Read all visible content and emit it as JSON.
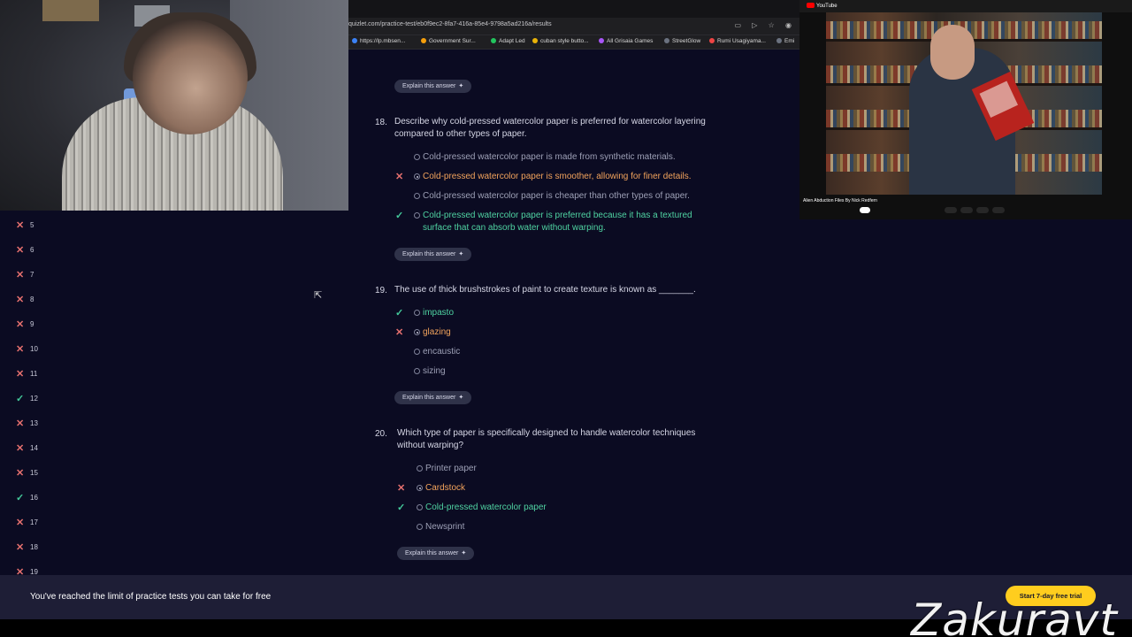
{
  "browser": {
    "url": "quizlet.com/practice-test/eb0f9ec2-8fa7-416a-85e4-9798a5ad216a/results",
    "bookmarks": [
      {
        "label": "https://lp.mbsen...",
        "color": "#3b82f6"
      },
      {
        "label": "Government Sur...",
        "color": "#f59e0b"
      },
      {
        "label": "Adapt Led",
        "color": "#22c55e"
      },
      {
        "label": "cuban style butto...",
        "color": "#eab308"
      },
      {
        "label": "All Grisaia Games",
        "color": "#a855f7"
      },
      {
        "label": "StreetGlow",
        "color": "#6b7280"
      },
      {
        "label": "Rumi Usagiyama...",
        "color": "#ef4444"
      },
      {
        "label": "Emi",
        "color": "#6b7280"
      }
    ]
  },
  "sidebar": {
    "items": [
      {
        "num": "5",
        "status": "wrong"
      },
      {
        "num": "6",
        "status": "wrong"
      },
      {
        "num": "7",
        "status": "wrong"
      },
      {
        "num": "8",
        "status": "wrong"
      },
      {
        "num": "9",
        "status": "wrong"
      },
      {
        "num": "10",
        "status": "wrong"
      },
      {
        "num": "11",
        "status": "wrong"
      },
      {
        "num": "12",
        "status": "right"
      },
      {
        "num": "13",
        "status": "wrong"
      },
      {
        "num": "14",
        "status": "wrong"
      },
      {
        "num": "15",
        "status": "wrong"
      },
      {
        "num": "16",
        "status": "right"
      },
      {
        "num": "17",
        "status": "wrong"
      },
      {
        "num": "18",
        "status": "wrong"
      },
      {
        "num": "19",
        "status": "wrong"
      }
    ]
  },
  "explain_label": "Explain this answer",
  "sparkle_glyph": "✦",
  "questions": [
    {
      "number": "18.",
      "text": "Describe why cold-pressed watercolor paper is preferred for watercolor layering compared to other types of paper.",
      "options": [
        "Cold-pressed watercolor paper is made from synthetic materials.",
        "Cold-pressed watercolor paper is smoother, allowing for finer details.",
        "Cold-pressed watercolor paper is cheaper than other types of paper.",
        "Cold-pressed watercolor paper is preferred because it has a textured surface that can absorb water without warping."
      ]
    },
    {
      "number": "19.",
      "text": "The use of thick brushstrokes of paint to create texture is known as _______.",
      "options": [
        "impasto",
        "glazing",
        "encaustic",
        "sizing"
      ]
    },
    {
      "number": "20.",
      "text": "Which type of paper is specifically designed to handle watercolor techniques without warping?",
      "options": [
        "Printer paper",
        "Cardstock",
        "Cold-pressed watercolor paper",
        "Newsprint"
      ]
    }
  ],
  "marks": {
    "wrong": "✕",
    "right": "✓"
  },
  "banner": {
    "text": "You've reached the limit of practice tests you can take for free",
    "button": "Start 7-day free trial"
  },
  "youtube": {
    "logo": "YouTube",
    "video_title": "Alien Abduction Files By Nick Redfern"
  },
  "watermark": "Zakuravt",
  "colors": {
    "correct": "#4fd3a2",
    "wrong": "#e5706e",
    "chosen_wrong": "#f2a35c",
    "accent_button": "#ffcd1e",
    "page_bg": "#0b0b22"
  }
}
